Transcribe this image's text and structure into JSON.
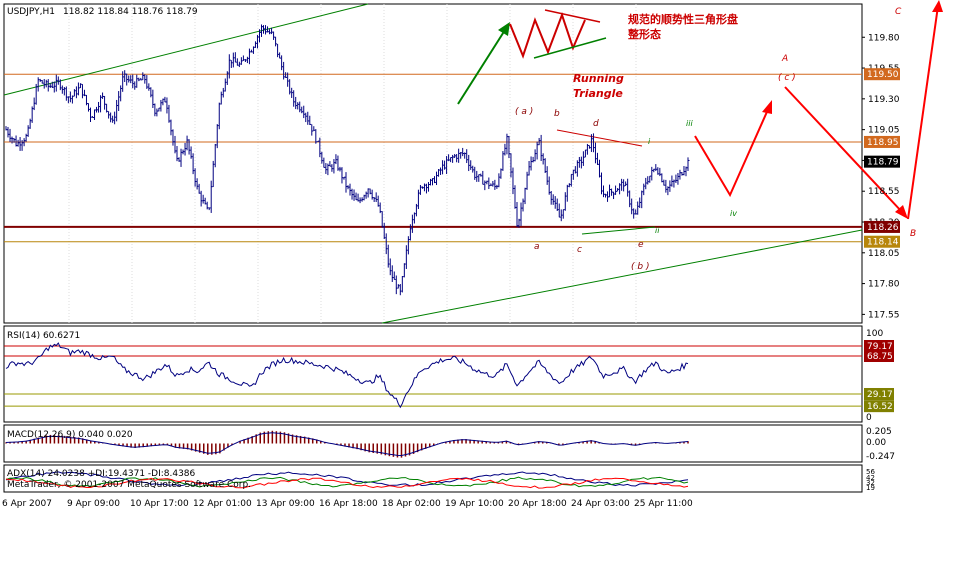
{
  "chart_data": {
    "type": "line",
    "symbol_header": "USDJPY,H1",
    "ohlc_header": "118.82 118.84 118.76 118.79",
    "last_price": "118.79",
    "annotation_chinese_line1": "规范的顺势性三角形盘",
    "annotation_chinese_line2": "整形态",
    "annotation_running_line1": "Running",
    "annotation_running_line2": "Triangle",
    "price_axis": {
      "ylim": [
        117.48,
        120.07
      ],
      "ticks": [
        "119.80",
        "119.55",
        "119.30",
        "119.05",
        "118.80",
        "118.55",
        "118.30",
        "118.05",
        "117.80",
        "117.55"
      ],
      "tick_values": [
        119.8,
        119.55,
        119.3,
        119.05,
        118.8,
        118.55,
        118.3,
        118.05,
        117.8,
        117.55
      ]
    },
    "horizontal_levels": [
      {
        "label": "119.50",
        "value": 119.5,
        "color": "#d2691e"
      },
      {
        "label": "118.95",
        "value": 118.95,
        "color": "#d2691e"
      },
      {
        "label": "118.26",
        "value": 118.26,
        "color": "#800000"
      },
      {
        "label": "118.14",
        "value": 118.14,
        "color": "#b8860b"
      }
    ],
    "price_series": [
      119.05,
      118.93,
      119.0,
      119.45,
      119.4,
      119.43,
      119.3,
      119.4,
      119.15,
      119.32,
      119.1,
      119.48,
      119.42,
      119.47,
      119.2,
      119.3,
      118.78,
      118.95,
      118.55,
      118.37,
      119.25,
      119.62,
      119.57,
      119.7,
      119.88,
      119.82,
      119.52,
      119.28,
      119.2,
      119.0,
      118.72,
      118.78,
      118.58,
      118.45,
      118.58,
      118.42,
      117.9,
      117.72,
      118.3,
      118.6,
      118.62,
      118.75,
      118.83,
      118.86,
      118.68,
      118.62,
      118.58,
      118.97,
      118.26,
      118.72,
      118.95,
      118.55,
      118.32,
      118.68,
      118.8,
      118.97,
      118.52,
      118.55,
      118.62,
      118.33,
      118.62,
      118.75,
      118.57,
      118.65,
      118.79
    ],
    "time_axis": {
      "ticks": [
        "6 Apr 2007",
        "9 Apr 09:00",
        "10 Apr 17:00",
        "12 Apr 01:00",
        "13 Apr 09:00",
        "16 Apr 18:00",
        "18 Apr 02:00",
        "19 Apr 10:00",
        "20 Apr 18:00",
        "24 Apr 03:00",
        "25 Apr 11:00"
      ]
    },
    "wave_labels": {
      "a_paren": "( a )",
      "b": "b",
      "d": "d",
      "i": "i",
      "iii": "iii",
      "a": "a",
      "c": "c",
      "e": "e",
      "ii": "ii",
      "b_paren": "( b )",
      "iv": "iv",
      "A": "A",
      "c_paren": "( c )",
      "B": "B",
      "C": "C"
    },
    "rsi": {
      "header": "RSI(14) 60.6271",
      "levels": [
        {
          "label": "79.17",
          "value": 79.17
        },
        {
          "label": "68.75",
          "value": 68.75
        },
        {
          "label": "29.17",
          "value": 29.17
        },
        {
          "label": "16.52",
          "value": 16.52
        }
      ],
      "scale_top": "100",
      "scale_bottom": "0",
      "ylim": [
        0,
        100
      ],
      "series": [
        58,
        62,
        60,
        65,
        78,
        80,
        72,
        74,
        70,
        66,
        68,
        55,
        50,
        45,
        52,
        60,
        48,
        55,
        53,
        62,
        50,
        45,
        40,
        35,
        52,
        60,
        65,
        64,
        62,
        60,
        58,
        55,
        50,
        45,
        40,
        48,
        30,
        18,
        38,
        55,
        60,
        65,
        66,
        62,
        55,
        50,
        48,
        60,
        38,
        52,
        62,
        50,
        40,
        52,
        60,
        68,
        48,
        52,
        55,
        42,
        54,
        62,
        50,
        55,
        60.6
      ]
    },
    "macd": {
      "header": "MACD(12,26,9) 0.040 0.020",
      "ticks": [
        "0.205",
        "0.00",
        "-0.247"
      ],
      "ylim": [
        -0.32,
        0.32
      ],
      "histogram": [
        0.02,
        0.03,
        0.05,
        0.1,
        0.15,
        0.14,
        0.12,
        0.1,
        0.05,
        0.02,
        -0.02,
        -0.05,
        -0.08,
        -0.06,
        -0.04,
        -0.02,
        -0.08,
        -0.1,
        -0.15,
        -0.2,
        -0.18,
        -0.05,
        0.05,
        0.12,
        0.2,
        0.22,
        0.2,
        0.15,
        0.12,
        0.08,
        0.02,
        -0.02,
        -0.06,
        -0.1,
        -0.15,
        -0.18,
        -0.22,
        -0.25,
        -0.2,
        -0.12,
        -0.05,
        0.02,
        0.06,
        0.08,
        0.06,
        0.04,
        0.02,
        0.05,
        -0.03,
        0.0,
        0.04,
        0.02,
        -0.04,
        0.0,
        0.03,
        0.06,
        0.0,
        -0.02,
        0.0,
        -0.04,
        0.0,
        0.02,
        0.0,
        0.02,
        0.04
      ]
    },
    "adx": {
      "header": "ADX(14) 24.0238 +DI:19.4371 -DI:8.4386",
      "ticks": [
        "56",
        "42",
        "32",
        "19",
        "8"
      ]
    },
    "copyright": "MetaTrader, © 2001-2007 MetaQuotes Software Corp."
  },
  "colors": {
    "bars": "#000080",
    "grid": "#c0c0c0",
    "green_trend": "#008000",
    "red_projection": "#ff0000",
    "annotation_red": "#c00000"
  }
}
